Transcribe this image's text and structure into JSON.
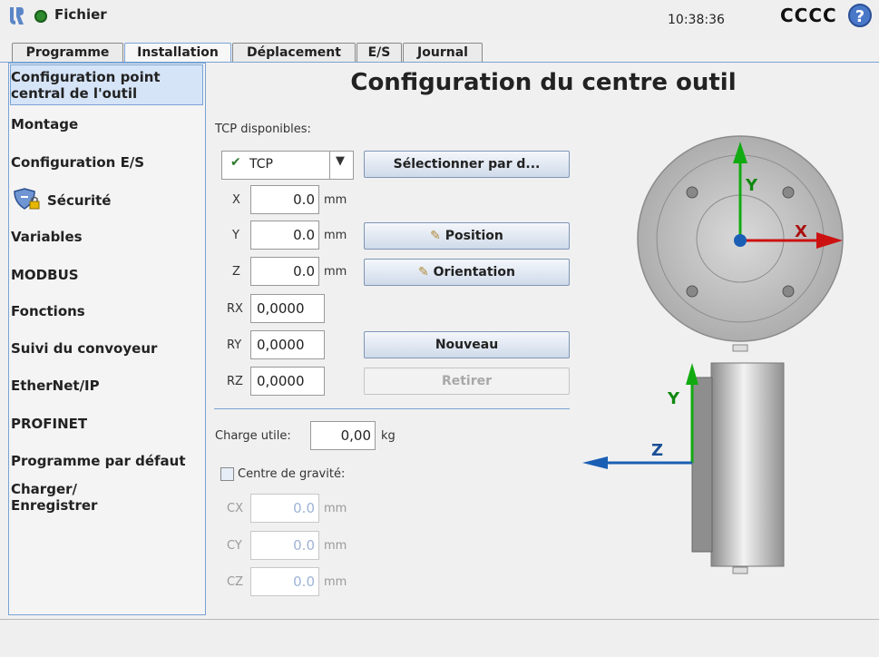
{
  "header": {
    "menu_label": "Fichier",
    "time": "10:38:36",
    "robot_name": "CCCC",
    "help_label": "?"
  },
  "tabs": [
    {
      "label": "Programme",
      "active": false
    },
    {
      "label": "Installation",
      "active": true
    },
    {
      "label": "Déplacement",
      "active": false
    },
    {
      "label": "E/S",
      "active": false
    },
    {
      "label": "Journal",
      "active": false
    }
  ],
  "sidebar": {
    "items": [
      {
        "label": "Configuration point central de l'outil",
        "selected": true
      },
      {
        "label": "Montage"
      },
      {
        "label": "Configuration E/S"
      },
      {
        "label": "Sécurité"
      },
      {
        "label": "Variables"
      },
      {
        "label": "MODBUS"
      },
      {
        "label": "Fonctions"
      },
      {
        "label": "Suivi du convoyeur"
      },
      {
        "label": "EtherNet/IP"
      },
      {
        "label": "PROFINET"
      },
      {
        "label": "Programme par défaut"
      },
      {
        "label": "Charger/ Enregistrer"
      }
    ]
  },
  "main": {
    "title": "Configuration du centre outil",
    "tcp_label": "TCP disponibles:",
    "tcp_selected": "TCP",
    "btn_select": "Sélectionner par d...",
    "btn_position": "Position",
    "btn_orientation": "Orientation",
    "btn_new": "Nouveau",
    "btn_remove": "Retirer",
    "fields": {
      "x": {
        "label": "X",
        "value": "0.0",
        "unit": "mm"
      },
      "y": {
        "label": "Y",
        "value": "0.0",
        "unit": "mm"
      },
      "z": {
        "label": "Z",
        "value": "0.0",
        "unit": "mm"
      },
      "rx": {
        "label": "RX",
        "value": "0,0000"
      },
      "ry": {
        "label": "RY",
        "value": "0,0000"
      },
      "rz": {
        "label": "RZ",
        "value": "0,0000"
      }
    },
    "payload_label": "Charge utile:",
    "payload_value": "0,00",
    "payload_unit": "kg",
    "cog_label": "Centre de gravité:",
    "cog": {
      "cx": {
        "label": "CX",
        "value": "0.0",
        "unit": "mm"
      },
      "cy": {
        "label": "CY",
        "value": "0.0",
        "unit": "mm"
      },
      "cz": {
        "label": "CZ",
        "value": "0.0",
        "unit": "mm"
      }
    }
  },
  "diagram": {
    "top_x": "X",
    "top_y": "Y",
    "side_y": "Y",
    "side_z": "Z",
    "colors": {
      "x": "#cc1111",
      "y": "#11aa11",
      "z": "#1a5fb4",
      "origin": "#1a5fb4"
    }
  }
}
